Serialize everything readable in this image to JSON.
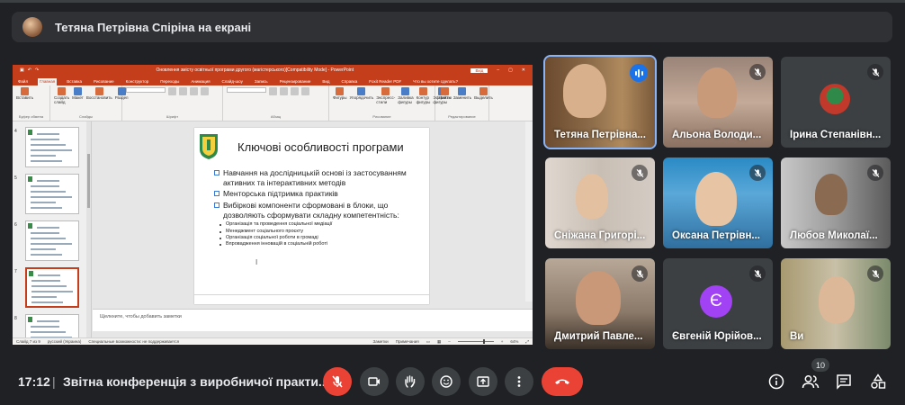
{
  "banner": {
    "presenting_label": "Тетяна Петрівна Спіріна на екрані"
  },
  "powerpoint": {
    "window_title": "Оновлення змісту освітньої програми другого (магістерського)[Compatibility Mode] - PowerPoint",
    "share_label": "Вхід",
    "tabs": [
      "Файл",
      "Главная",
      "Вставка",
      "Рисование",
      "Конструктор",
      "Переходы",
      "Анимация",
      "Слайд-шоу",
      "Запись",
      "Рецензирование",
      "Вид",
      "Справка",
      "Foxit Reader PDF",
      "Что вы хотите сделать?"
    ],
    "active_tab_index": 1,
    "ribbon_groups": [
      {
        "caption": "Буфер обмена",
        "items": [
          "Вставить"
        ]
      },
      {
        "caption": "Слайды",
        "items": [
          "Создать слайд",
          "Макет",
          "Восстановить",
          "Раздел"
        ]
      },
      {
        "caption": "Шрифт",
        "items": []
      },
      {
        "caption": "Абзац",
        "items": []
      },
      {
        "caption": "Рисование",
        "items": [
          "Фигуры",
          "Упорядочить",
          "Экспресс-стили",
          "Заливка фигуры",
          "Контур фигуры",
          "Эффекты фигуры"
        ]
      },
      {
        "caption": "Редактирование",
        "items": [
          "Найти",
          "Заменить",
          "Выделить"
        ]
      }
    ],
    "thumbnails": [
      {
        "num": "4"
      },
      {
        "num": "5"
      },
      {
        "num": "6"
      },
      {
        "num": "7",
        "selected": true
      },
      {
        "num": "8"
      }
    ],
    "slide": {
      "title": "Ключові особливості програми",
      "bullets": [
        "Навчання на дослідницькій основі із застосуванням активних та інтерактивних методів",
        "Менторська підтримка практиків",
        "Вибіркові компоненти сформовані в блоки, що дозволяють сформувати складну компетентність:"
      ],
      "sub_bullets": [
        "Організація та проведення соціальної медіації",
        "Менеджмент соціального проєкту",
        "Організація соціальної роботи в громаді",
        "Впровадження інновацій в соціальній роботі"
      ]
    },
    "notes_placeholder": "Щелкните, чтобы добавить заметки",
    "status": {
      "slide_info": "Слайд 7 из 9",
      "language": "русский (Украина)",
      "accessibility": "Специальные возможности: не поддерживается",
      "notes_btn": "Заметки",
      "comments_btn": "Примечания",
      "zoom": "64%"
    }
  },
  "participants": [
    {
      "name": "Тетяна Петрівна...",
      "state": "speaking"
    },
    {
      "name": "Альона Володи...",
      "state": "muted"
    },
    {
      "name": "Ірина Степанівн...",
      "state": "muted"
    },
    {
      "name": "Сніжана Григорі...",
      "state": "muted"
    },
    {
      "name": "Оксана Петрівн...",
      "state": "muted"
    },
    {
      "name": "Любов Миколаї...",
      "state": "muted"
    },
    {
      "name": "Дмитрий Павле...",
      "state": "muted"
    },
    {
      "name": "Євгеній Юрійов...",
      "state": "muted",
      "avatar_letter": "Є",
      "avatar_color": "#a142f4"
    },
    {
      "name": "Ви",
      "state": "muted"
    }
  ],
  "bottom_bar": {
    "time": "17:12",
    "separator": "|",
    "meeting_title": "Звітна конференція з виробничої практи...",
    "participant_count": "10",
    "buttons": [
      "mic-off",
      "camera",
      "raise-hand",
      "emoji",
      "present",
      "more",
      "end-call"
    ],
    "right_buttons": [
      "info",
      "people",
      "chat",
      "activities"
    ]
  },
  "colors": {
    "background": "#202124",
    "end_call": "#ea4335",
    "accent": "#8ab4f8",
    "ppt_brand": "#c43e1c"
  }
}
